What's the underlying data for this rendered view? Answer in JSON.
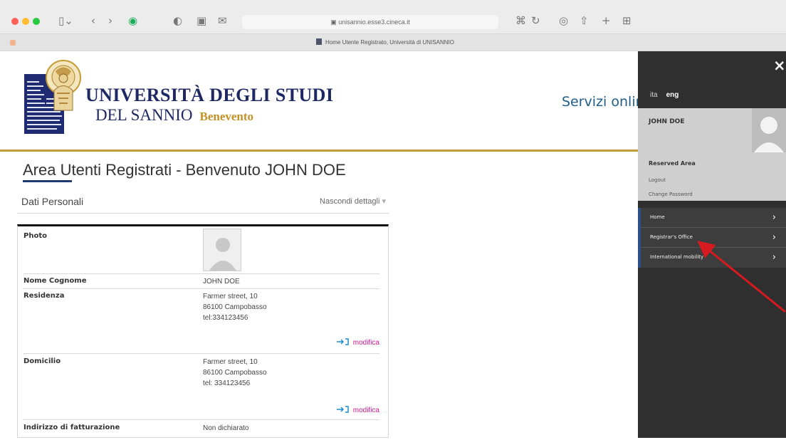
{
  "browser": {
    "url": "unisannio.esse3.cineca.it",
    "tab_title": "Home Utente Registrato, Università di UNISANNIO"
  },
  "header": {
    "university_line1": "UNIVERSITÀ DEGLI STUDI",
    "university_line2": "DEL SANNIO",
    "city": "Benevento",
    "services": "Servizi onlin"
  },
  "page": {
    "title": "Area Utenti Registrati - Benvenuto JOHN DOE",
    "panel_title": "Dati Personali",
    "panel_toggle": "Nascondi dettagli",
    "edit_label": "modifica",
    "rows": [
      {
        "label": "Photo",
        "value": ""
      },
      {
        "label": "Nome Cognome",
        "value": "JOHN DOE"
      },
      {
        "label": "Residenza",
        "value": "Farmer street, 10\n86100 Campobasso\ntel:334123456"
      },
      {
        "label": "Domicilio",
        "value": "Farmer street, 10\n86100 Campobasso\ntel: 334123456"
      },
      {
        "label": "Indirizzo di fatturazione",
        "value": "Non dichiarato"
      }
    ]
  },
  "side_menu": {
    "close": "×",
    "lang_ita": "ita",
    "lang_eng": "eng",
    "user_name": "JOHN DOE",
    "reserved_area": "Reserved Area",
    "logout": "Logout",
    "change_password": "Change Password",
    "items": [
      {
        "label": "Home"
      },
      {
        "label": "Registrar's Office"
      },
      {
        "label": "International mobility"
      }
    ]
  },
  "colors": {
    "navy": "#1e2863",
    "gold": "#c39d3d",
    "menu_accent": "#2c518a",
    "edit_pink": "#d0178e",
    "annotation_red": "#d71920"
  }
}
